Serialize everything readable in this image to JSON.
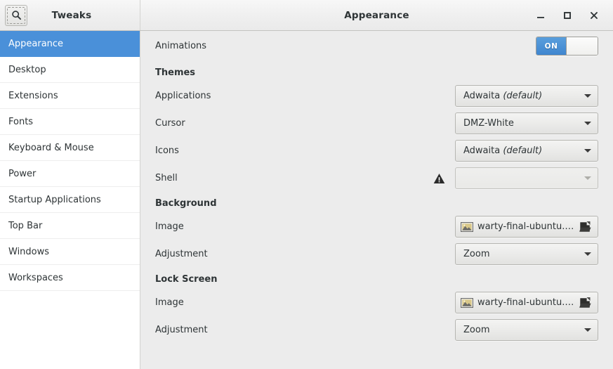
{
  "window": {
    "app_title": "Tweaks",
    "page_title": "Appearance",
    "search_icon": "search-icon",
    "controls": [
      {
        "name": "minimize",
        "glyph": "minimize-icon"
      },
      {
        "name": "maximize",
        "glyph": "maximize-icon"
      },
      {
        "name": "close",
        "glyph": "close-icon"
      }
    ]
  },
  "colors": {
    "accent": "#4a90d9",
    "switch_on": "#3f86cf",
    "sidebar_bg": "#ffffff",
    "content_bg": "#ececec",
    "header_bg": "#efefef",
    "text": "#2e3436"
  },
  "sidebar": {
    "items": [
      {
        "label": "Appearance",
        "selected": true
      },
      {
        "label": "Desktop",
        "selected": false
      },
      {
        "label": "Extensions",
        "selected": false
      },
      {
        "label": "Fonts",
        "selected": false
      },
      {
        "label": "Keyboard & Mouse",
        "selected": false
      },
      {
        "label": "Power",
        "selected": false
      },
      {
        "label": "Startup Applications",
        "selected": false
      },
      {
        "label": "Top Bar",
        "selected": false
      },
      {
        "label": "Windows",
        "selected": false
      },
      {
        "label": "Workspaces",
        "selected": false
      }
    ]
  },
  "main": {
    "animations": {
      "label": "Animations",
      "switch_state": "ON",
      "switch_on_label": "ON"
    },
    "themes": {
      "heading": "Themes",
      "applications": {
        "label": "Applications",
        "value": "Adwaita",
        "value_suffix": "(default)"
      },
      "cursor": {
        "label": "Cursor",
        "value": "DMZ-White",
        "value_suffix": ""
      },
      "icons": {
        "label": "Icons",
        "value": "Adwaita",
        "value_suffix": "(default)"
      },
      "shell": {
        "label": "Shell",
        "value": "",
        "value_suffix": "",
        "warning_icon": "warning-icon",
        "disabled": true
      }
    },
    "background": {
      "heading": "Background",
      "image": {
        "label": "Image",
        "filename": "warty-final-ubuntu.png",
        "thumb_icon": "image-thumbnail-icon",
        "open_icon": "open-document-icon"
      },
      "adjustment": {
        "label": "Adjustment",
        "value": "Zoom"
      }
    },
    "lock_screen": {
      "heading": "Lock Screen",
      "image": {
        "label": "Image",
        "filename": "warty-final-ubuntu.png",
        "thumb_icon": "image-thumbnail-icon",
        "open_icon": "open-document-icon"
      },
      "adjustment": {
        "label": "Adjustment",
        "value": "Zoom"
      }
    }
  }
}
